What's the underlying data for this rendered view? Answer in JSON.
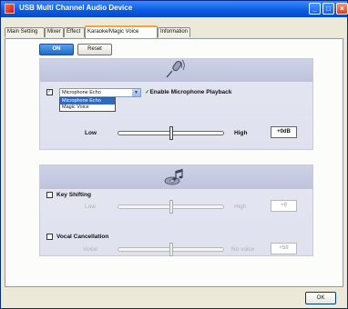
{
  "window": {
    "title": "USB Multi Channel Audio Device"
  },
  "tabs": [
    {
      "label": "Main Setting"
    },
    {
      "label": "Mixer"
    },
    {
      "label": "Effect"
    },
    {
      "label": "Karaoke/Magic Voice"
    },
    {
      "label": "Information"
    }
  ],
  "active_tab": "Karaoke/Magic Voice",
  "toolbar": {
    "on_label": "ON",
    "reset_label": "Reset"
  },
  "microphone": {
    "icon": "microphone-icon",
    "echo_checked": true,
    "select_value": "Microphone Echo",
    "options": [
      "Microphone Echo",
      "Magic Voice"
    ],
    "enable_playback_label": "Enable Microphone Playback",
    "low_label": "Low",
    "high_label": "High",
    "value": "+0dB",
    "level": 0.5
  },
  "magic": {
    "icon": "music-note-icon",
    "key_shifting": {
      "label": "Key Shifting",
      "checked": false,
      "low_label": "Low",
      "high_label": "High",
      "value": "+0",
      "level": 0.5
    },
    "vocal_cancellation": {
      "label": "Vocal Cancellation",
      "checked": false,
      "low_label": "Voice",
      "high_label": "No voice",
      "value": "+50",
      "level": 0.5
    }
  },
  "ok_label": "OK",
  "colors": {
    "title_bar": "#0a5be0",
    "on_button": "#1f69c9",
    "group_bg": "#e2e4f0",
    "active_tab_accent": "#f5a43a"
  }
}
